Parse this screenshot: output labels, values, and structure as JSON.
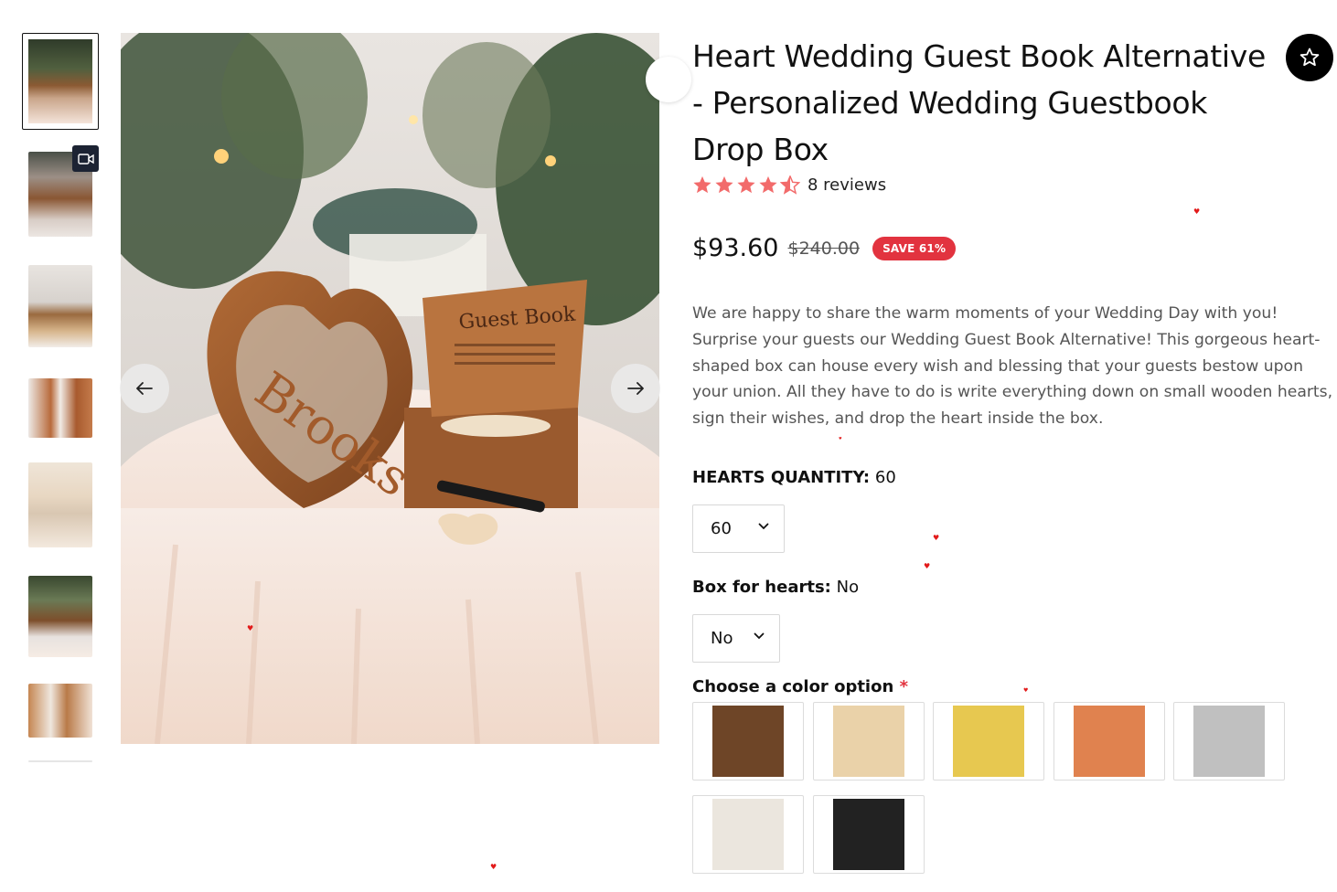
{
  "product": {
    "title": "Heart Wedding Guest Book Alternative - Personalized Wedding Guestbook Drop Box",
    "rating": 4.5,
    "reviews_label": "8 reviews",
    "price": "$93.60",
    "compare_price": "$240.00",
    "save_badge": "SAVE 61%",
    "description": "We are happy to share the warm moments of your Wedding Day with you! Surprise your guests our Wedding Guest Book Alternative! This gorgeous heart-shaped box can house every wish and blessing that your guests bestow upon your union. All they have to do is write everything down on small wooden hearts, sign their wishes, and drop the heart inside the box."
  },
  "options": {
    "hearts_quantity": {
      "label": "HEARTS QUANTITY:",
      "value": "60",
      "selected": "60"
    },
    "box_for_hearts": {
      "label": "Box for hearts:",
      "value": "No",
      "selected": "No"
    },
    "color": {
      "label": "Choose a color option",
      "required_mark": "*",
      "swatches": [
        {
          "name": "walnut",
          "color": "#6e4527"
        },
        {
          "name": "natural",
          "color": "#ead2a9"
        },
        {
          "name": "gold",
          "color": "#e7c850"
        },
        {
          "name": "copper",
          "color": "#e0824f"
        },
        {
          "name": "silver",
          "color": "#c0c0c0"
        },
        {
          "name": "white-wash",
          "color": "#ebe6de"
        },
        {
          "name": "black",
          "color": "#222222"
        }
      ]
    }
  },
  "icons": {
    "prev": "arrow-left-icon",
    "next": "arrow-right-icon",
    "favorite": "star-outline-icon",
    "video": "video-camera-icon"
  },
  "colors": {
    "accent_red": "#e2333f",
    "star": "#f26b6b"
  }
}
